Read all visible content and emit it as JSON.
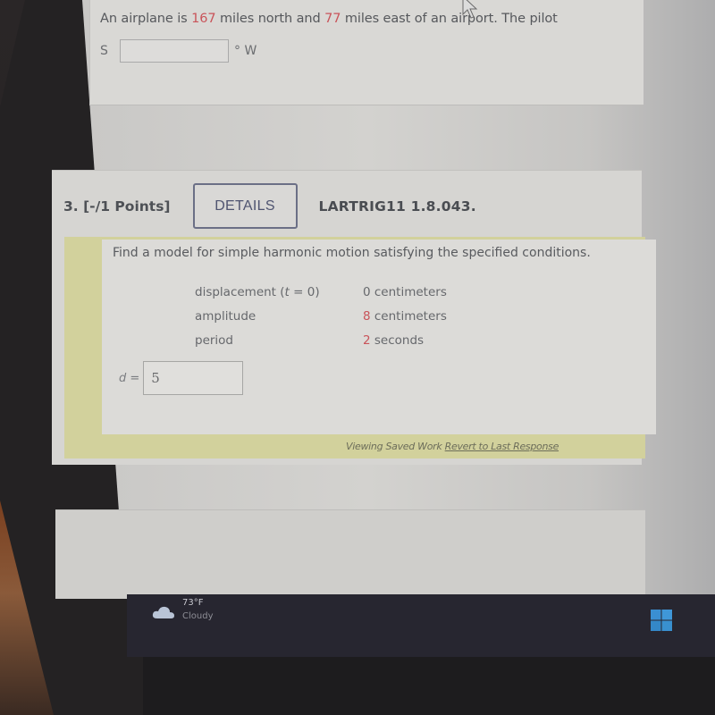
{
  "previous_question": {
    "text_before_north": "An airplane is ",
    "north_miles": "167",
    "text_between": " miles north and ",
    "east_miles": "77",
    "text_after": " miles east of an airport. The pilot",
    "answer_direction_prefix": "S",
    "answer_value": "",
    "answer_direction_suffix": "° W"
  },
  "question": {
    "number_and_points": "3. [-/1 Points]",
    "details_button": "DETAILS",
    "reference": "LARTRIG11 1.8.043.",
    "prompt": "Find a model for simple harmonic motion satisfying the specified conditions.",
    "conditions": [
      {
        "label_prefix": "displacement (",
        "label_var": "t",
        "label_suffix": " = 0)",
        "value_num": "0",
        "value_unit": " centimeters",
        "num_highlight": false
      },
      {
        "label_prefix": "amplitude",
        "label_var": "",
        "label_suffix": "",
        "value_num": "8",
        "value_unit": " centimeters",
        "num_highlight": true
      },
      {
        "label_prefix": "period",
        "label_var": "",
        "label_suffix": "",
        "value_num": "2",
        "value_unit": " seconds",
        "num_highlight": true
      }
    ],
    "answer_label": "d =",
    "answer_value": "5",
    "saved_work_text": "Viewing Saved Work ",
    "revert_link": "Revert to Last Response"
  },
  "taskbar": {
    "weather_icon": "cloud-icon",
    "temperature": "73°F",
    "condition": "Cloudy",
    "start_icon": "windows-start-icon"
  },
  "colors": {
    "highlight_number": "#c9545a",
    "details_border": "#6b6f86",
    "yellow_frame": "#d2d19c",
    "taskbar": "#272630",
    "start_button": "#3b8fd0"
  }
}
